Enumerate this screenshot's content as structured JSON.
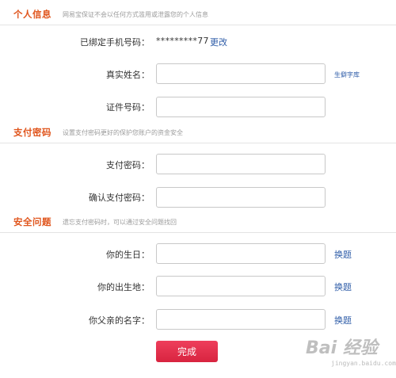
{
  "sections": {
    "personal": {
      "title": "个人信息",
      "desc": "网易宝保证不会以任何方式滥用或泄露您的个人信息"
    },
    "payment": {
      "title": "支付密码",
      "desc": "设置支付密码更好的保护您账户的资金安全"
    },
    "security": {
      "title": "安全问题",
      "desc": "遗忘支付密码时，可以通过安全问题找回"
    }
  },
  "personal": {
    "phone_label": "已绑定手机号码：",
    "phone_value": "*********77",
    "phone_change": "更改",
    "name_label": "真实姓名：",
    "name_value": "",
    "rare_chars_link": "生僻字库",
    "id_label": "证件号码：",
    "id_value": ""
  },
  "payment": {
    "password_label": "支付密码：",
    "confirm_label": "确认支付密码："
  },
  "security": {
    "q1_label": "你的生日：",
    "q2_label": "你的出生地：",
    "q3_label": "你父亲的名字：",
    "change_question": "换题"
  },
  "submit_label": "完成",
  "watermark": {
    "text": "Bai 经验",
    "url": "jingyan.baidu.com"
  }
}
